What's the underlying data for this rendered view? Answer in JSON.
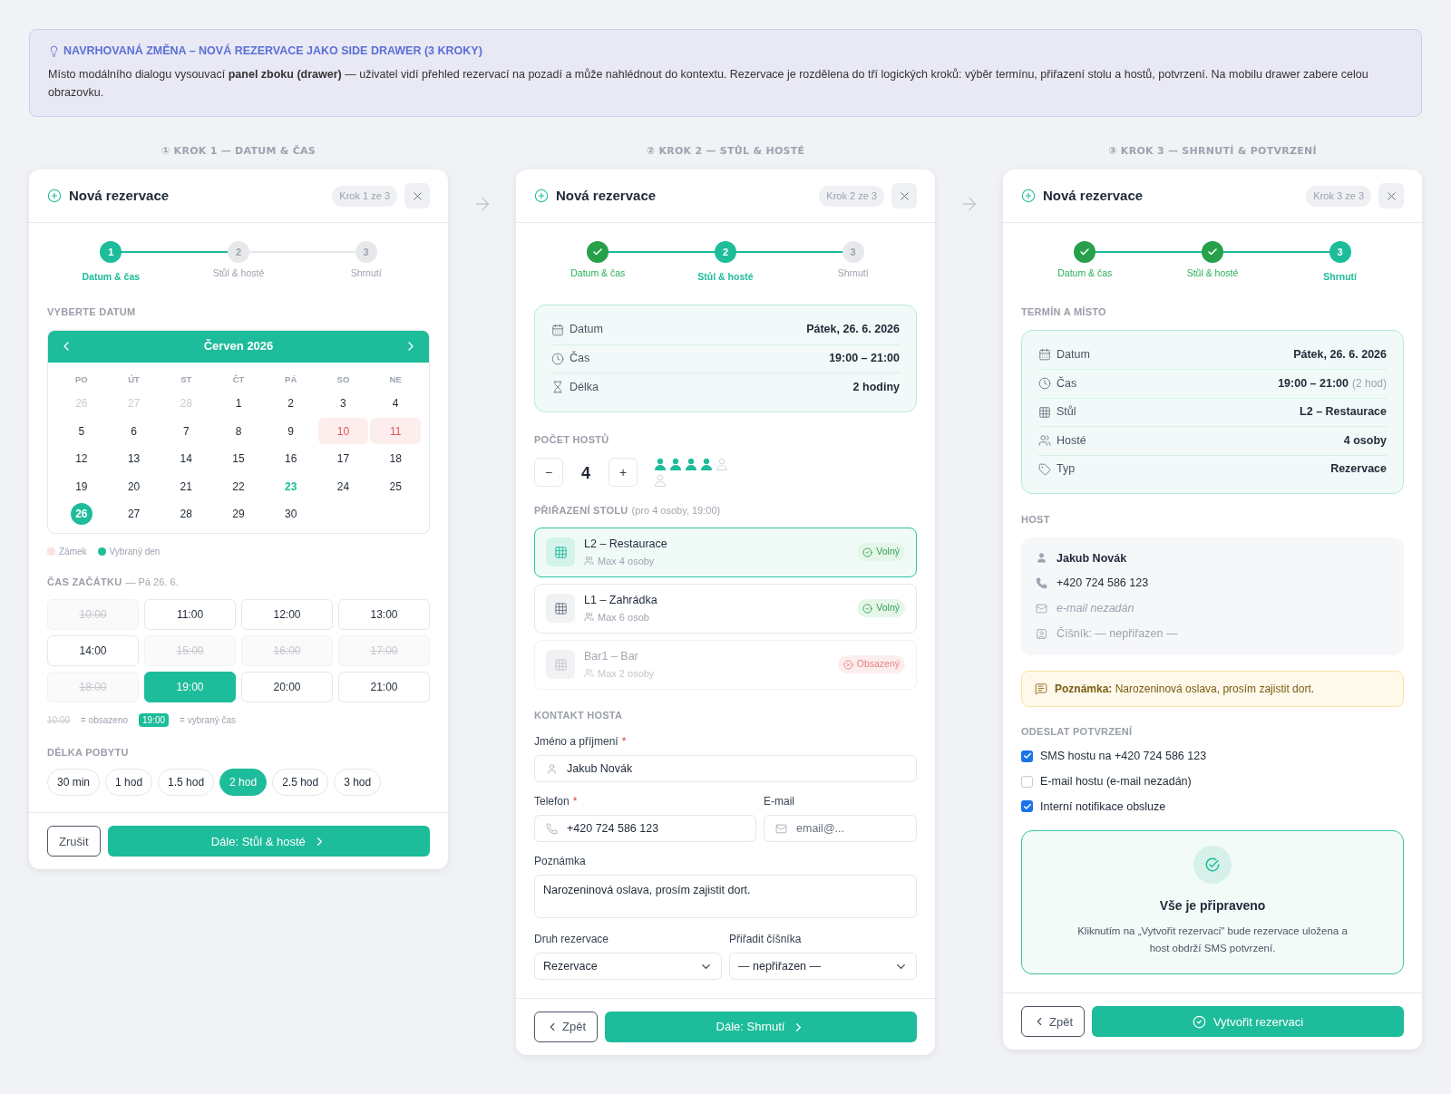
{
  "banner": {
    "title": "NAVRHOVANÁ ZMĚNA – NOVÁ REZERVACE JAKO SIDE DRAWER (3 KROKY)",
    "text": "Místo modálního dialogu vysouvací **panel zboku (drawer)** — uživatel vidí přehled rezervací na pozadí a může nahlédnout do kontextu. Rezervace je rozdělena do tří logických kroků: výběr termínu, přiřazení stolu a hostů, potvrzení. Na mobilu drawer zabere celou obrazovku."
  },
  "step1": {
    "caption": "① KROK 1 — DATUM & ČAS",
    "title": "Nová rezervace",
    "badge": "Krok 1 ze 3",
    "stepper": [
      {
        "number": "1",
        "label": "Datum & čas",
        "done": false,
        "selected": true
      },
      {
        "number": "2",
        "label": "Stůl & hosté",
        "done": false,
        "selected": false
      },
      {
        "number": "3",
        "label": "Shrnutí",
        "done": false,
        "selected": false
      }
    ],
    "date_title": "VYBERTE DATUM",
    "calendar": {
      "month": "Červen 2026",
      "weekdays": [
        "PO",
        "ÚT",
        "ST",
        "ČT",
        "PÁ",
        "SO",
        "NE"
      ],
      "days": [
        {
          "d": "26",
          "kind": "outside",
          "selected": false
        },
        {
          "d": "27",
          "kind": "outside",
          "selected": false
        },
        {
          "d": "28",
          "kind": "outside",
          "selected": false
        },
        {
          "d": "1",
          "kind": "normal",
          "selected": false
        },
        {
          "d": "2",
          "kind": "normal",
          "selected": false
        },
        {
          "d": "3",
          "kind": "normal",
          "selected": false
        },
        {
          "d": "4",
          "kind": "normal",
          "selected": false
        },
        {
          "d": "5",
          "kind": "normal",
          "selected": false
        },
        {
          "d": "6",
          "kind": "normal",
          "selected": false
        },
        {
          "d": "7",
          "kind": "normal",
          "selected": false
        },
        {
          "d": "8",
          "kind": "normal",
          "selected": false
        },
        {
          "d": "9",
          "kind": "normal",
          "selected": false
        },
        {
          "d": "10",
          "kind": "locked",
          "selected": false
        },
        {
          "d": "11",
          "kind": "locked",
          "selected": false
        },
        {
          "d": "12",
          "kind": "normal",
          "selected": false
        },
        {
          "d": "13",
          "kind": "normal",
          "selected": false
        },
        {
          "d": "14",
          "kind": "normal",
          "selected": false
        },
        {
          "d": "15",
          "kind": "normal",
          "selected": false
        },
        {
          "d": "16",
          "kind": "normal",
          "selected": false
        },
        {
          "d": "17",
          "kind": "normal",
          "selected": false
        },
        {
          "d": "18",
          "kind": "normal",
          "selected": false
        },
        {
          "d": "19",
          "kind": "normal",
          "selected": false
        },
        {
          "d": "20",
          "kind": "normal",
          "selected": false
        },
        {
          "d": "21",
          "kind": "normal",
          "selected": false
        },
        {
          "d": "22",
          "kind": "normal",
          "selected": false
        },
        {
          "d": "23",
          "kind": "today",
          "selected": false
        },
        {
          "d": "24",
          "kind": "normal",
          "selected": false
        },
        {
          "d": "25",
          "kind": "normal",
          "selected": false
        },
        {
          "d": "26",
          "kind": "normal",
          "selected": true
        },
        {
          "d": "27",
          "kind": "normal",
          "selected": false
        },
        {
          "d": "28",
          "kind": "normal",
          "selected": false
        },
        {
          "d": "29",
          "kind": "normal",
          "selected": false
        },
        {
          "d": "30",
          "kind": "normal",
          "selected": false
        }
      ]
    },
    "legend": [
      {
        "label": "Zámek",
        "kind": "locked"
      },
      {
        "label": "Vybraný den",
        "kind": "selected"
      }
    ],
    "time_title": "ČAS ZAČÁTKU",
    "time_subtitle": "— Pá 26. 6.",
    "times": [
      {
        "label": "10:00",
        "taken": true,
        "selected": false
      },
      {
        "label": "11:00",
        "taken": false,
        "selected": false
      },
      {
        "label": "12:00",
        "taken": false,
        "selected": false
      },
      {
        "label": "13:00",
        "taken": false,
        "selected": false
      },
      {
        "label": "14:00",
        "taken": false,
        "selected": false
      },
      {
        "label": "15:00",
        "taken": true,
        "selected": false
      },
      {
        "label": "16:00",
        "taken": true,
        "selected": false
      },
      {
        "label": "17:00",
        "taken": true,
        "selected": false
      },
      {
        "label": "18:00",
        "taken": true,
        "selected": false
      },
      {
        "label": "19:00",
        "taken": false,
        "selected": true
      },
      {
        "label": "20:00",
        "taken": false,
        "selected": false
      },
      {
        "label": "21:00",
        "taken": false,
        "selected": false
      }
    ],
    "time_legend": [
      {
        "sample": "10:00",
        "kind": "taken",
        "text": "= obsazeno"
      },
      {
        "sample": "19:00",
        "kind": "selected",
        "text": "= vybraný čas"
      }
    ],
    "duration_title": "DÉLKA POBYTU",
    "durations": [
      {
        "label": "30 min",
        "selected": false
      },
      {
        "label": "1 hod",
        "selected": false
      },
      {
        "label": "1.5 hod",
        "selected": false
      },
      {
        "label": "2 hod",
        "selected": true
      },
      {
        "label": "2.5 hod",
        "selected": false
      },
      {
        "label": "3 hod",
        "selected": false
      }
    ],
    "buttons": [
      {
        "label": "Zrušit",
        "kind": "cancel"
      },
      {
        "label": "Dále: Stůl & hosté",
        "kind": "next"
      }
    ]
  },
  "step2": {
    "caption": "② KROK 2 — STŮL & HOSTÉ",
    "title": "Nová rezervace",
    "badge": "Krok 2 ze 3",
    "stepper": [
      {
        "label": "Datum & čas",
        "done": true,
        "selected": false
      },
      {
        "number": "2",
        "label": "Stůl & hosté",
        "done": false,
        "selected": true
      },
      {
        "number": "3",
        "label": "Shrnutí",
        "done": false,
        "selected": false
      }
    ],
    "summary": [
      {
        "kind": "date",
        "label": "Datum",
        "value": "Pátek, 26. 6. 2026"
      },
      {
        "kind": "time",
        "label": "Čas",
        "value": "19:00 – 21:00"
      },
      {
        "kind": "duration",
        "label": "Délka",
        "value": "2 hodiny"
      }
    ],
    "guests_title": "POČET HOSTŮ",
    "guests": {
      "minus": "−",
      "count": "4",
      "plus": "+",
      "icons": [
        {
          "filled": true
        },
        {
          "filled": true
        },
        {
          "filled": true
        },
        {
          "filled": true
        },
        {
          "filled": false
        },
        {
          "filled": false
        }
      ]
    },
    "table_title": "PŘIŘAZENÍ STOLU",
    "table_hint": "(pro 4 osoby, 19:00)",
    "tables": [
      {
        "name": "L2 – Restaurace",
        "capacity": "Max 4 osoby",
        "status": "Volný",
        "available": true,
        "selected": true
      },
      {
        "name": "L1 – Zahrádka",
        "capacity": "Max 6 osob",
        "status": "Volný",
        "available": true,
        "selected": false
      },
      {
        "name": "Bar1 – Bar",
        "capacity": "Max 2 osoby",
        "status": "Obsazený",
        "available": false,
        "selected": false
      }
    ],
    "contact_title": "KONTAKT HOSTA",
    "name_field": {
      "label": "Jméno a příjmení",
      "required_mark": "*",
      "value": "Jakub Novák"
    },
    "phone_field": {
      "label": "Telefon",
      "required_mark": "*",
      "value": "+420 724 586 123"
    },
    "email_field": {
      "label": "E-mail",
      "placeholder": "email@..."
    },
    "note_field": {
      "label": "Poznámka",
      "value": "Narozeninová oslava, prosím zajistit dort."
    },
    "type_select": {
      "label": "Druh rezervace",
      "value": "Rezervace"
    },
    "waiter_select": {
      "label": "Přiřadit číšníka",
      "value": "— nepřiřazen —"
    },
    "buttons": [
      {
        "label": "Zpět",
        "kind": "back"
      },
      {
        "label": "Dále: Shrnutí",
        "kind": "next"
      }
    ]
  },
  "step3": {
    "caption": "③ KROK 3 — SHRNUTÍ & POTVRZENÍ",
    "title": "Nová rezervace",
    "badge": "Krok 3 ze 3",
    "stepper": [
      {
        "label": "Datum & čas",
        "done": true,
        "selected": false
      },
      {
        "label": "Stůl & hosté",
        "done": true,
        "selected": false
      },
      {
        "number": "3",
        "label": "Shrnutí",
        "done": false,
        "selected": true
      }
    ],
    "summary_title": "TERMÍN A MÍSTO",
    "summary": [
      {
        "kind": "date",
        "label": "Datum",
        "value": "Pátek, 26. 6. 2026"
      },
      {
        "kind": "time",
        "label": "Čas",
        "value": "19:00 – 21:00",
        "note": "(2 hod)"
      },
      {
        "kind": "table",
        "label": "Stůl",
        "value": "L2 – Restaurace"
      },
      {
        "kind": "guests",
        "label": "Hosté",
        "value": "4 osoby"
      },
      {
        "kind": "type",
        "label": "Typ",
        "value": "Rezervace"
      }
    ],
    "host_title": "HOST",
    "host": [
      {
        "kind": "name",
        "text": "Jakub Novák"
      },
      {
        "kind": "phone",
        "text": "+420 724 586 123"
      },
      {
        "kind": "email",
        "text": "e-mail nezadán"
      },
      {
        "kind": "waiter",
        "text": "Číšník: — nepřiřazen —"
      }
    ],
    "note": "**Poznámka:** Narozeninová oslava, prosím zajistit dort.",
    "confirm_title": "ODESLAT POTVRZENÍ",
    "confirm": [
      {
        "label": "SMS hostu na +420 724 586 123",
        "checked": true
      },
      {
        "label": "E-mail hostu (e-mail nezadán)",
        "checked": false
      },
      {
        "label": "Interní notifikace obsluze",
        "checked": true
      }
    ],
    "ready": {
      "title": "Vše je připraveno",
      "text": "Kliknutím na „Vytvořit rezervaci\" bude rezervace uložena a host obdrží SMS potvrzení."
    },
    "buttons": [
      {
        "label": "Zpět",
        "kind": "back"
      },
      {
        "label": "Vytvořit rezervaci",
        "kind": "create"
      }
    ]
  }
}
